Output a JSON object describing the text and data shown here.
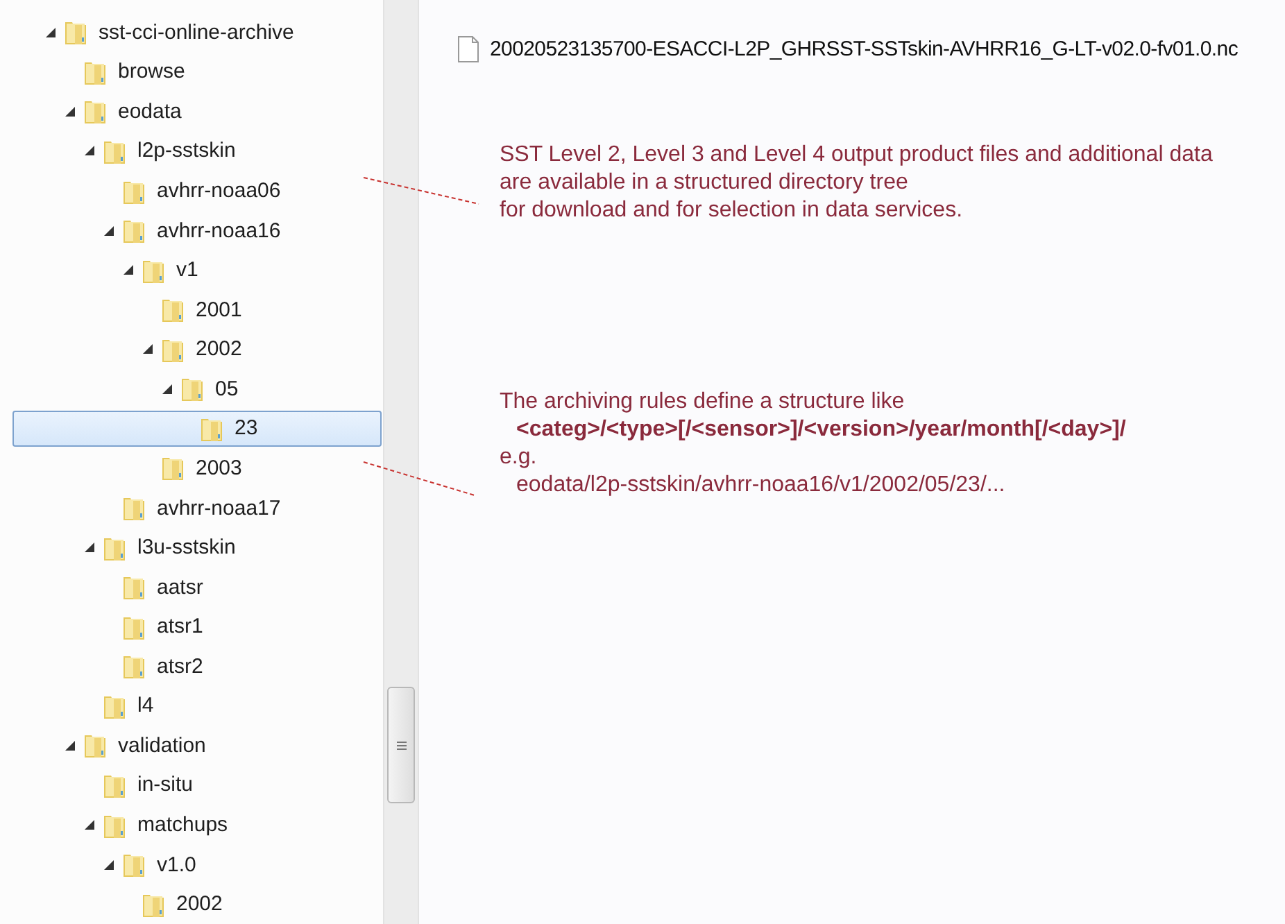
{
  "tree": [
    {
      "label": "sst-cci-online-archive",
      "expanded": true,
      "selected": false,
      "children": [
        {
          "label": "browse",
          "selected": false
        },
        {
          "label": "eodata",
          "expanded": true,
          "selected": false,
          "children": [
            {
              "label": "l2p-sstskin",
              "expanded": true,
              "selected": false,
              "children": [
                {
                  "label": "avhrr-noaa06",
                  "selected": false
                },
                {
                  "label": "avhrr-noaa16",
                  "expanded": true,
                  "selected": false,
                  "children": [
                    {
                      "label": "v1",
                      "expanded": true,
                      "selected": false,
                      "children": [
                        {
                          "label": "2001",
                          "selected": false
                        },
                        {
                          "label": "2002",
                          "expanded": true,
                          "selected": false,
                          "children": [
                            {
                              "label": "05",
                              "expanded": true,
                              "selected": false,
                              "children": [
                                {
                                  "label": "23",
                                  "selected": true
                                }
                              ]
                            }
                          ]
                        },
                        {
                          "label": "2003",
                          "selected": false
                        }
                      ]
                    }
                  ]
                },
                {
                  "label": "avhrr-noaa17",
                  "selected": false
                }
              ]
            },
            {
              "label": "l3u-sstskin",
              "expanded": true,
              "selected": false,
              "children": [
                {
                  "label": "aatsr",
                  "selected": false
                },
                {
                  "label": "atsr1",
                  "selected": false
                },
                {
                  "label": "atsr2",
                  "selected": false
                }
              ]
            },
            {
              "label": "l4",
              "selected": false
            }
          ]
        },
        {
          "label": "validation",
          "expanded": true,
          "selected": false,
          "children": [
            {
              "label": "in-situ",
              "selected": false
            },
            {
              "label": "matchups",
              "expanded": true,
              "selected": false,
              "children": [
                {
                  "label": "v1.0",
                  "expanded": true,
                  "selected": false,
                  "children": [
                    {
                      "label": "2002",
                      "selected": false
                    }
                  ]
                }
              ]
            }
          ]
        }
      ]
    }
  ],
  "file": {
    "name": "20020523135700-ESACCI-L2P_GHRSST-SSTskin-AVHRR16_G-LT-v02.0-fv01.0.nc"
  },
  "note_1": [
    "SST Level 2, Level 3 and Level 4 output product files and additional data",
    "are available in a structured directory tree",
    "for download and for selection in data services."
  ],
  "note_2": [
    {
      "text": "The archiving rules define a structure like",
      "kind": "plain"
    },
    {
      "text": "<categ>/<type>[/<sensor>]/<version>/year/month[/<day>]/",
      "kind": "bold"
    },
    {
      "text": "e.g.",
      "kind": "plain"
    },
    {
      "text": "eodata/l2p-sstskin/avhrr-noaa16/v1/2002/05/23/...",
      "kind": "indented"
    }
  ]
}
